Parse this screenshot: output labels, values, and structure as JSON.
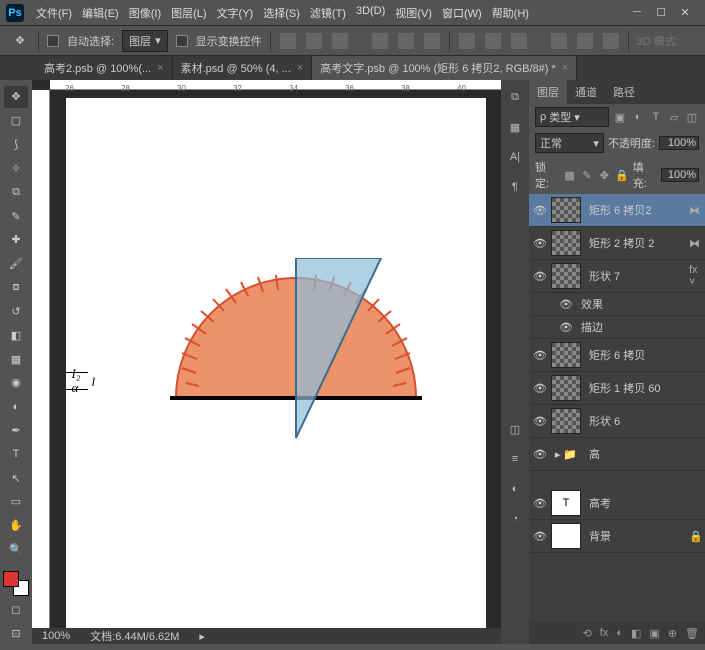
{
  "app": {
    "logo": "Ps"
  },
  "menu": [
    "文件(F)",
    "编辑(E)",
    "图像(I)",
    "图层(L)",
    "文字(Y)",
    "选择(S)",
    "滤镜(T)",
    "3D(D)",
    "视图(V)",
    "窗口(W)",
    "帮助(H)"
  ],
  "options": {
    "auto_select": "自动选择:",
    "target": "图层",
    "show_transform": "显示变换控件",
    "mode3d": "3D 模式:"
  },
  "tabs": [
    {
      "label": "高考2.psb @ 100%(...",
      "active": false
    },
    {
      "label": "素材.psd @ 50% (4, ...",
      "active": false
    },
    {
      "label": "高考文字.psb @ 100% (矩形 6  拷贝2, RGB/8#) *",
      "active": true
    }
  ],
  "ruler_ticks": [
    "26",
    "28",
    "30",
    "32",
    "34",
    "36",
    "38",
    "40"
  ],
  "canvas_labels": {
    "l1": "I₂",
    "l2": "α",
    "l3": "l"
  },
  "status": {
    "zoom": "100%",
    "docinfo": "文档:6.44M/6.62M"
  },
  "panel": {
    "tabs": [
      "图层",
      "通道",
      "路径"
    ],
    "type_filter": "类型",
    "blend": "正常",
    "opacity_label": "不透明度:",
    "opacity": "100%",
    "lock_label": "锁定:",
    "fill_label": "填充:",
    "fill": "100%"
  },
  "layers": [
    {
      "name": "矩形 6  拷贝2",
      "sel": true,
      "link": true,
      "indent": 0
    },
    {
      "name": "矩形 2 拷贝 2",
      "sel": false,
      "link": true,
      "indent": 0
    },
    {
      "name": "形状 7",
      "sel": false,
      "fx": true,
      "indent": 0
    },
    {
      "name": "效果",
      "sub": true
    },
    {
      "name": "描边",
      "sub": true
    },
    {
      "name": "矩形 6 拷贝",
      "sel": false,
      "indent": 0
    },
    {
      "name": "矩形 1 拷贝 60",
      "sel": false,
      "indent": 0
    },
    {
      "name": "形状 6",
      "sel": false,
      "indent": 0
    },
    {
      "name": "高",
      "grp": true,
      "indent": 0
    },
    {
      "name": "高考",
      "text": true,
      "indent": 0,
      "sep": true
    },
    {
      "name": "背景",
      "bg": true,
      "indent": 0,
      "lock": true
    }
  ],
  "foot_icons": [
    "⟲",
    "fx",
    "◐",
    "◧",
    "▣",
    "⊕",
    "🗑"
  ]
}
